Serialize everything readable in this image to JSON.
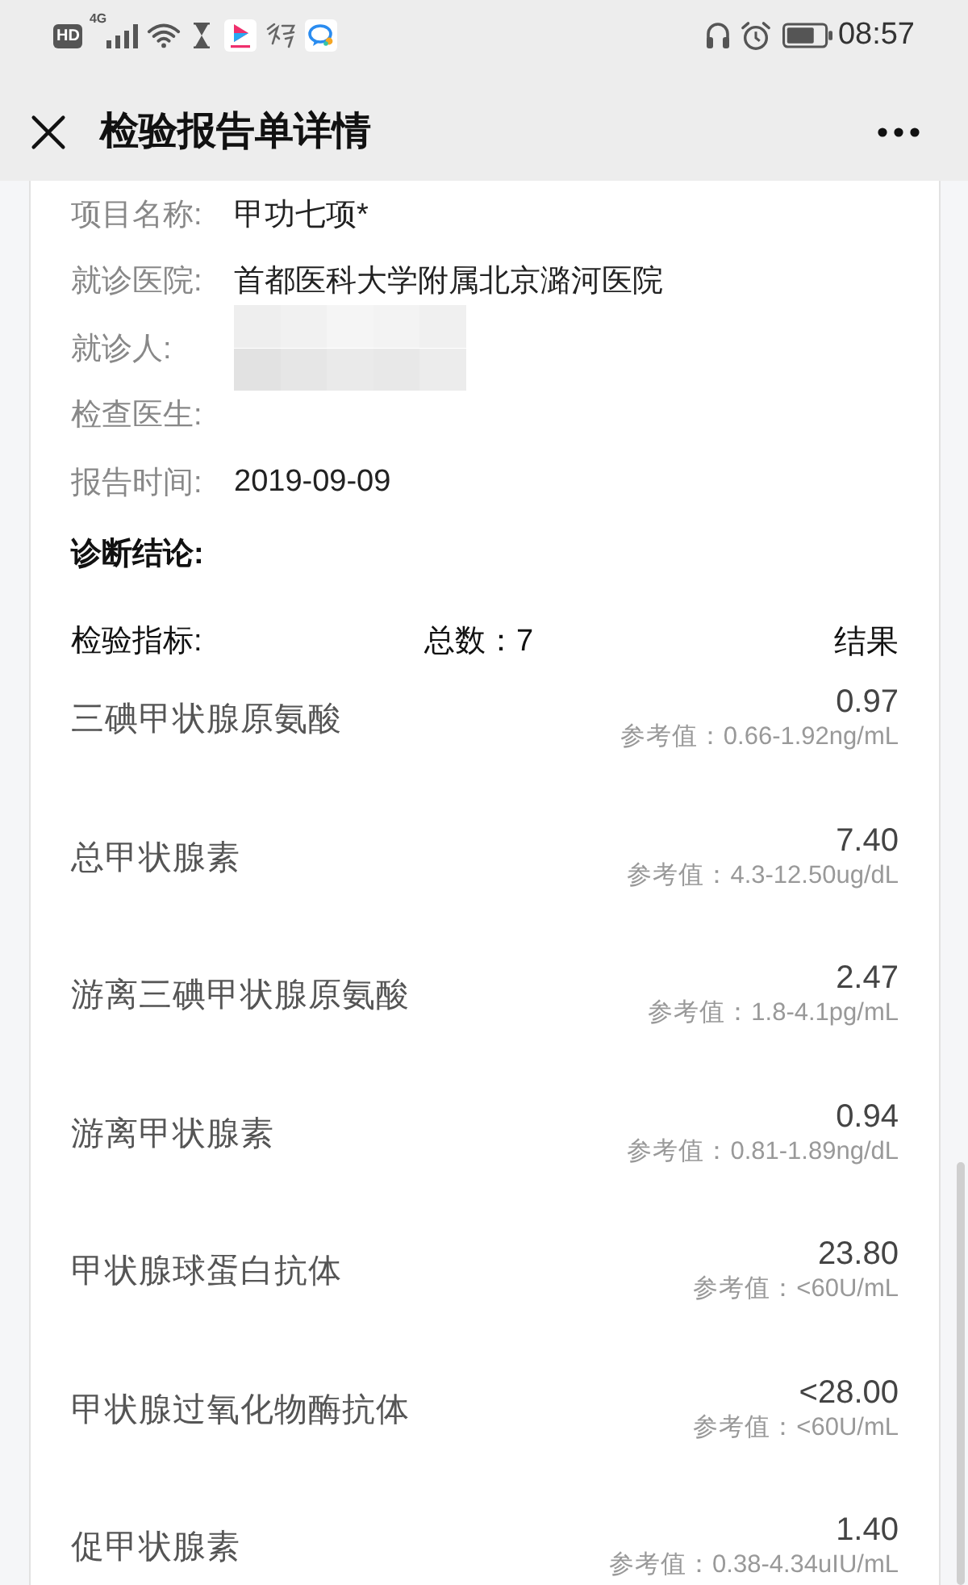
{
  "status_bar": {
    "hd_badge": "HD",
    "network": "4G",
    "time": "08:57"
  },
  "header": {
    "title": "检验报告单详情"
  },
  "report": {
    "fields": [
      {
        "label": "项目名称:",
        "value": "甲功七项*",
        "blurred": false
      },
      {
        "label": "就诊医院:",
        "value": "首都医科大学附属北京潞河医院",
        "blurred": false
      },
      {
        "label": "就诊人:",
        "blurred": true
      },
      {
        "label": "检查医生:",
        "blurred": false
      },
      {
        "label": "报告时间:",
        "value": "2019-09-09",
        "blurred": false
      }
    ],
    "diagnosis": {
      "label": "诊断结论:"
    }
  },
  "indicators": {
    "label": "检验指标:",
    "total": "总数：7",
    "result_label": "结果",
    "items": [
      {
        "name": "三碘甲状腺原氨酸",
        "value": "0.97",
        "reference": "参考值：0.66-1.92ng/mL"
      },
      {
        "name": "总甲状腺素",
        "value": "7.40",
        "reference": "参考值：4.3-12.50ug/dL"
      },
      {
        "name": "游离三碘甲状腺原氨酸",
        "value": "2.47",
        "reference": "参考值：1.8-4.1pg/mL"
      },
      {
        "name": "游离甲状腺素",
        "value": "0.94",
        "reference": "参考值：0.81-1.89ng/dL"
      },
      {
        "name": "甲状腺球蛋白抗体",
        "value": "23.80",
        "reference": "参考值：<60U/mL"
      },
      {
        "name": "甲状腺过氧化物酶抗体",
        "value": "<28.00",
        "reference": "参考值：<60U/mL"
      },
      {
        "name": "促甲状腺素",
        "value": "1.40",
        "reference": "参考值：0.38-4.34uIU/mL"
      }
    ]
  }
}
